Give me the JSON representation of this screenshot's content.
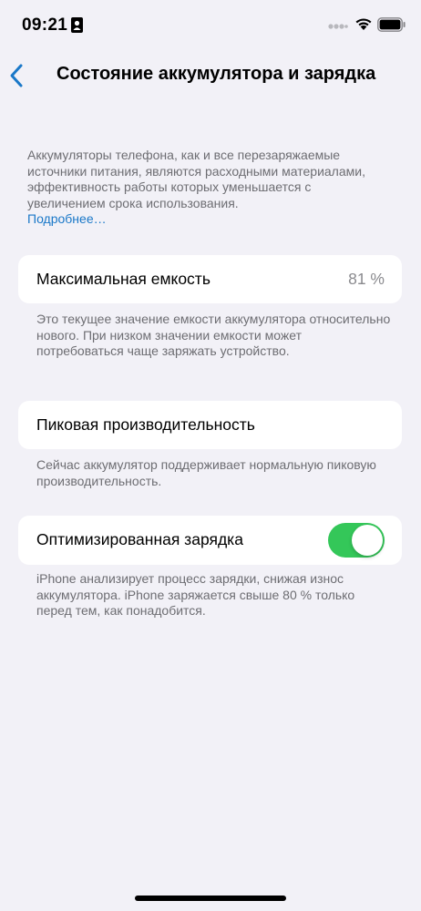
{
  "status_bar": {
    "time": "09:21",
    "id_icon": "contact-card-icon",
    "signal_icon": "cellular-signal-icon",
    "wifi_icon": "wifi-icon",
    "battery_icon": "battery-icon"
  },
  "nav": {
    "back_icon": "chevron-left-icon",
    "title": "Состояние аккумулятора и зарядка"
  },
  "intro": {
    "text": "Аккумуляторы телефона, как и все перезаряжаемые источники питания, являются расходными материалами, эффективность работы которых уменьшается с увеличением срока использования.",
    "link": "Подробнее…"
  },
  "capacity": {
    "label": "Максимальная емкость",
    "value": "81 %",
    "footnote": "Это текущее значение емкости аккумулятора относительно нового. При низком значении емкости может потребоваться чаще заряжать устройство."
  },
  "peak": {
    "label": "Пиковая производительность",
    "footnote": "Сейчас аккумулятор поддерживает нормальную пиковую производительность."
  },
  "optimized": {
    "label": "Оптимизированная зарядка",
    "enabled": true,
    "footnote": "iPhone анализирует процесс зарядки, снижая износ аккумулятора. iPhone заряжается свыше 80 % только перед тем, как понадобится."
  },
  "colors": {
    "background": "#f2f1f7",
    "accent": "#1a78c8",
    "toggle_on": "#34c759",
    "secondary_text": "#6d6d72"
  }
}
